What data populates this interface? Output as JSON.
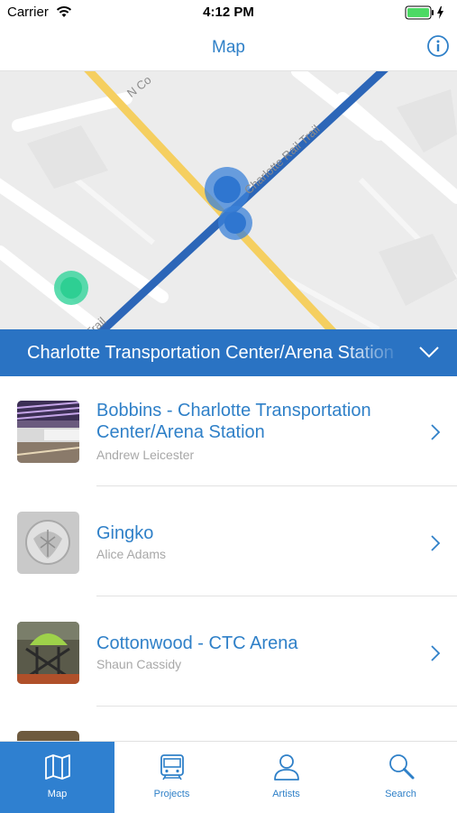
{
  "status_bar": {
    "carrier": "Carrier",
    "time": "4:12 PM"
  },
  "nav": {
    "title": "Map"
  },
  "map": {
    "street_labels": [
      "N Co",
      "Charlotte Rail Trail",
      "Trail"
    ],
    "colors": {
      "rail_line": "#2c66b8",
      "street": "#f5cf60",
      "station_marker": "#3b82d8",
      "user_marker": "#3ed6a0"
    }
  },
  "station": {
    "name": "Charlotte Transportation Center/Arena Station"
  },
  "artworks": [
    {
      "title": "Bobbins - Charlotte Transportation Center/Arena Station",
      "artist": "Andrew Leicester"
    },
    {
      "title": "Gingko",
      "artist": "Alice Adams"
    },
    {
      "title": "Cottonwood - CTC Arena",
      "artist": "Shaun Cassidy"
    }
  ],
  "tabs": [
    {
      "label": "Map",
      "icon": "map-icon",
      "active": true
    },
    {
      "label": "Projects",
      "icon": "train-icon",
      "active": false
    },
    {
      "label": "Artists",
      "icon": "person-icon",
      "active": false
    },
    {
      "label": "Search",
      "icon": "magnifier-icon",
      "active": false
    }
  ],
  "colors": {
    "accent": "#2f80c8",
    "station_bar": "#2a73c3",
    "active_tab": "#2f80d0"
  }
}
